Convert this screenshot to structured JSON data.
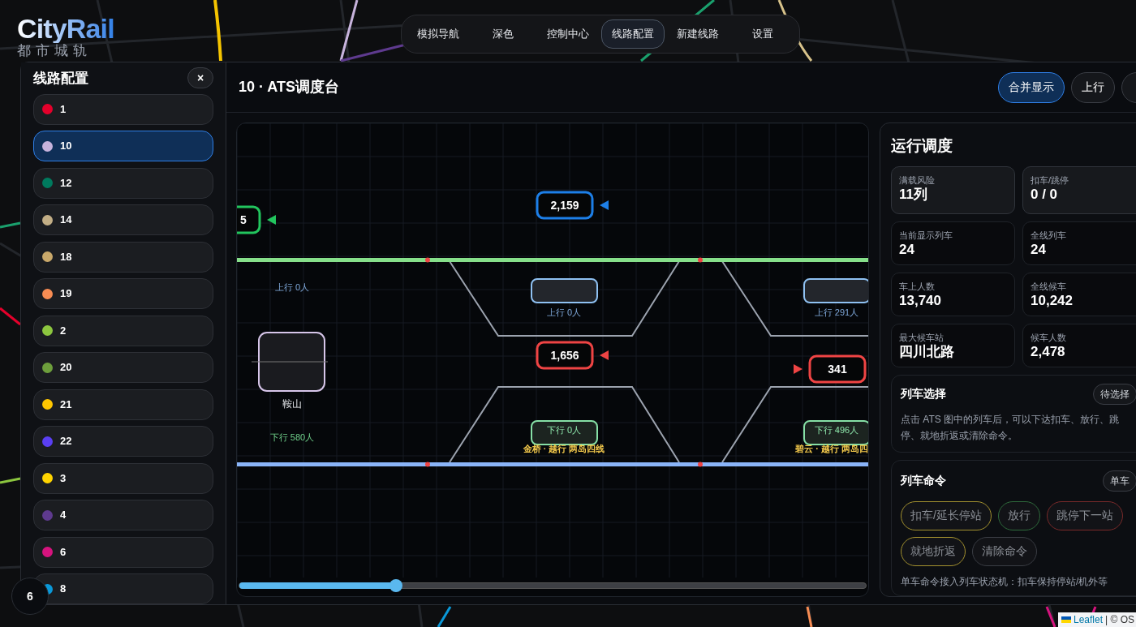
{
  "logo": {
    "title": "CityRail",
    "subtitle": "都市城轨"
  },
  "nav": [
    {
      "label": "模拟导航",
      "selected": false
    },
    {
      "label": "深色",
      "selected": false
    },
    {
      "label": "控制中心",
      "selected": false
    },
    {
      "label": "线路配置",
      "selected": true
    },
    {
      "label": "新建线路",
      "selected": false
    },
    {
      "label": "设置",
      "selected": false
    }
  ],
  "sidebar": {
    "title": "线路配置",
    "close": "×",
    "items": [
      {
        "label": "1",
        "color": "#e4002b",
        "selected": false
      },
      {
        "label": "10",
        "color": "#c7b3dc",
        "selected": true
      },
      {
        "label": "12",
        "color": "#007a5e",
        "selected": false
      },
      {
        "label": "14",
        "color": "#c2ae86",
        "selected": false
      },
      {
        "label": "18",
        "color": "#c9a86a",
        "selected": false
      },
      {
        "label": "19",
        "color": "#f78c53",
        "selected": false
      },
      {
        "label": "2",
        "color": "#8cc63f",
        "selected": false
      },
      {
        "label": "20",
        "color": "#6d9e3c",
        "selected": false
      },
      {
        "label": "21",
        "color": "#ffc600",
        "selected": false
      },
      {
        "label": "22",
        "color": "#5a3ff2",
        "selected": false
      },
      {
        "label": "3",
        "color": "#ffd400",
        "selected": false
      },
      {
        "label": "4",
        "color": "#5e3a8e",
        "selected": false
      },
      {
        "label": "6",
        "color": "#d6137e",
        "selected": false
      },
      {
        "label": "8",
        "color": "#0a98d8",
        "selected": false
      }
    ]
  },
  "header": {
    "title": "10 · ATS调度台",
    "buttons": [
      {
        "label": "合并显示",
        "selected": true
      },
      {
        "label": "上行",
        "selected": false
      },
      {
        "selected": false
      }
    ]
  },
  "ats": {
    "stations": [
      {
        "kind": "station",
        "name": "鞍山",
        "up": "上行 0人",
        "down": "下行 580人"
      },
      {
        "kind": "overtaking",
        "up": "上行 0人",
        "down": "下行 0人",
        "note": "金桥 · 越行 两岛四线"
      },
      {
        "kind": "overtaking",
        "up": "上行 291人",
        "down": "下行 496人",
        "note": "碧云 · 越行 两岛四"
      }
    ],
    "trains": [
      {
        "label": "5",
        "color": "#22c55e",
        "kind": "left"
      },
      {
        "label": "2,159",
        "color": "#1d7fe8",
        "kind": "left"
      },
      {
        "label": "1,656",
        "color": "#ef4444",
        "kind": "left"
      },
      {
        "label": "341",
        "color": "#ef4444",
        "kind": "right"
      }
    ],
    "timeline": {
      "level": 0.25
    }
  },
  "dispatch": {
    "title": "运行调度",
    "stats": [
      {
        "label": "满载风险",
        "value": "11列",
        "kind": "highlight"
      },
      {
        "label": "扣车/跳停",
        "value": "0 / 0",
        "kind": "highlight"
      },
      {
        "label": "当前显示列车",
        "value": "24",
        "kind": "plain"
      },
      {
        "label": "全线列车",
        "value": "24",
        "kind": "plain"
      },
      {
        "label": "车上人数",
        "value": "13,740",
        "kind": "plain"
      },
      {
        "label": "全线候车",
        "value": "10,242",
        "kind": "plain"
      },
      {
        "label": "最大候车站",
        "value": "四川北路",
        "kind": "plain"
      },
      {
        "label": "候车人数",
        "value": "2,478",
        "kind": "plain"
      }
    ],
    "selection": {
      "title": "列车选择",
      "badge": "待选择",
      "text": "点击 ATS 图中的列车后，可以下达扣车、放行、跳停、就地折返或清除命令。"
    },
    "commands": {
      "title": "列车命令",
      "badge": "单车",
      "buttons": [
        {
          "label": "扣车/延长停站",
          "color": "#a3912f",
          "disabled": true
        },
        {
          "label": "放行",
          "color": "#2f6b3c",
          "disabled": true
        },
        {
          "label": "跳停下一站",
          "color": "#7a2a2a",
          "disabled": true
        },
        {
          "label": "就地折返",
          "color": "#a3912f",
          "disabled": true
        },
        {
          "label": "清除命令",
          "color": "#3a3d44",
          "disabled": true
        }
      ],
      "note": "单车命令接入列车状态机：扣车保持停站/机外等"
    }
  },
  "zoom_badge": "6",
  "attribution": {
    "link": "Leaflet",
    "text": "| © OS"
  }
}
